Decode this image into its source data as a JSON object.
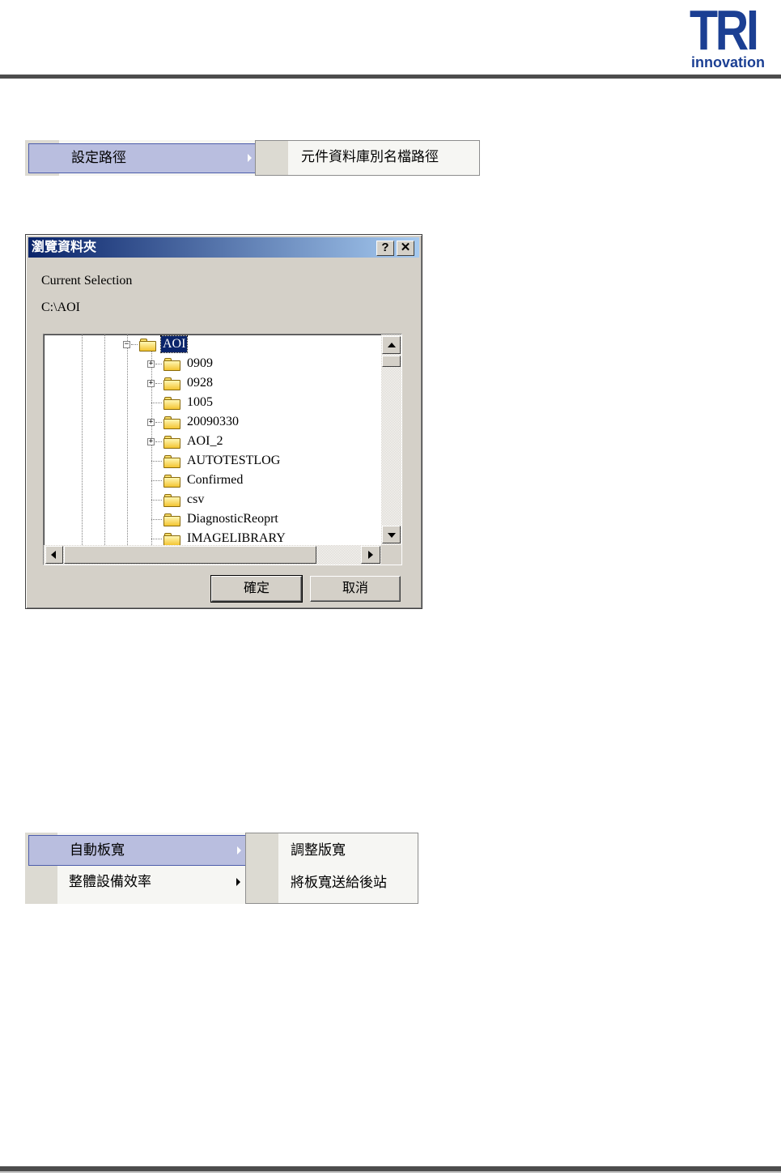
{
  "logo": {
    "brand": "TRI",
    "tagline": "innovation",
    "brand_color": "#1b3f93"
  },
  "menu1": {
    "item": "設定路徑",
    "submenu": [
      "元件資料庫別名檔路徑"
    ],
    "highlight_color": "#b9bedf"
  },
  "dialog": {
    "title": "瀏覽資料夾",
    "help_glyph": "?",
    "close_glyph": "✕",
    "current_selection_label": "Current Selection",
    "current_path": "C:\\AOI",
    "tree": {
      "selected": "AOI",
      "children": [
        {
          "label": "0909",
          "expandable": true
        },
        {
          "label": "0928",
          "expandable": true
        },
        {
          "label": "1005",
          "expandable": false
        },
        {
          "label": "20090330",
          "expandable": true
        },
        {
          "label": "AOI_2",
          "expandable": true
        },
        {
          "label": "AUTOTESTLOG",
          "expandable": false
        },
        {
          "label": "Confirmed",
          "expandable": false
        },
        {
          "label": "csv",
          "expandable": false
        },
        {
          "label": "DiagnosticReoprt",
          "expandable": false
        },
        {
          "label": "IMAGELIBRARY",
          "expandable": false
        }
      ]
    },
    "ok_label": "確定",
    "cancel_label": "取消",
    "titlebar_color": "#0a246a"
  },
  "menu2": {
    "items": [
      {
        "label": "自動板寬",
        "highlighted": true
      },
      {
        "label": "整體設備效率",
        "highlighted": false
      }
    ],
    "submenu": [
      "調整版寬",
      "將板寬送給後站"
    ]
  }
}
